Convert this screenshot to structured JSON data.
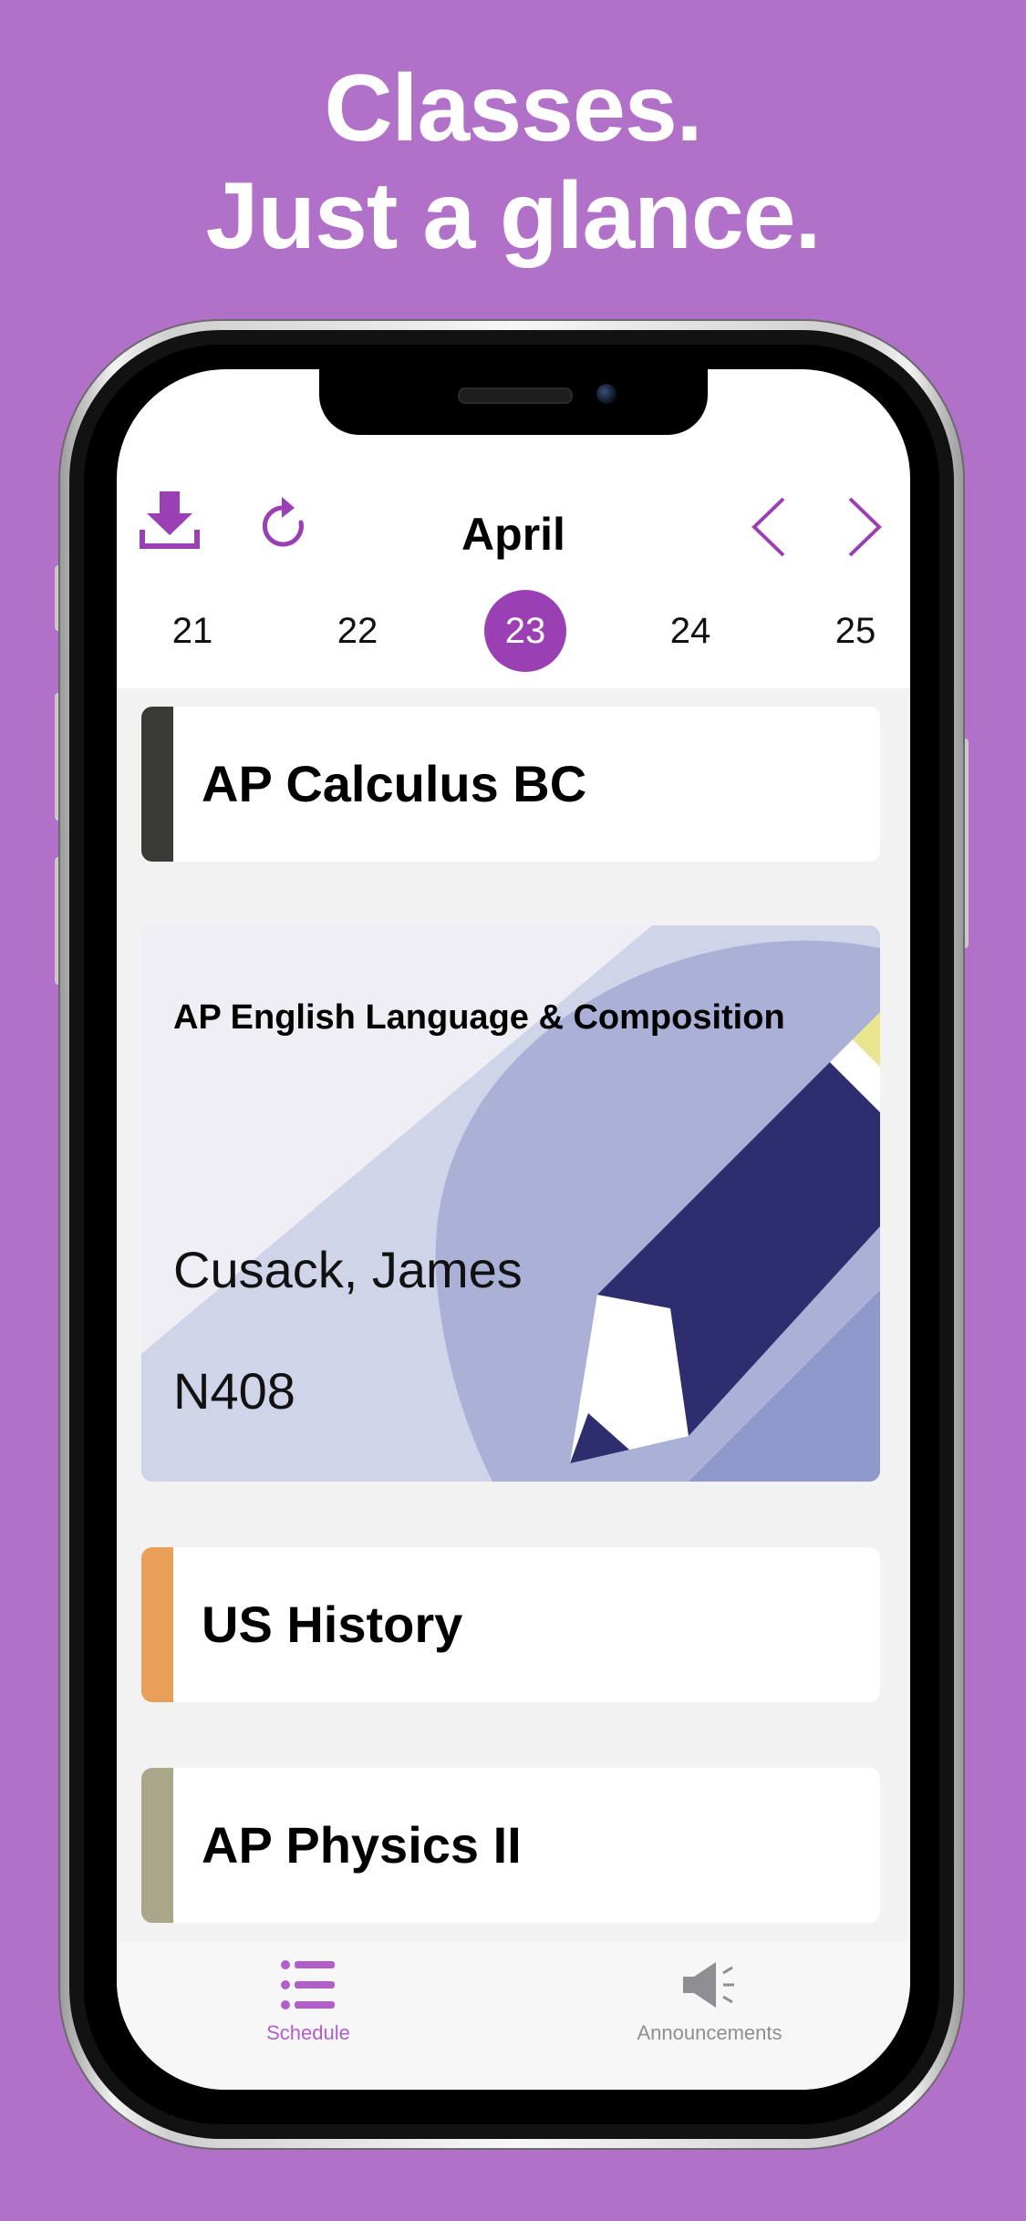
{
  "headline": {
    "line1": "Classes.",
    "line2": "Just a glance."
  },
  "header": {
    "month": "April",
    "icons": [
      "download-icon",
      "refresh-icon",
      "chevron-left-icon",
      "chevron-right-icon"
    ]
  },
  "dates": {
    "days": [
      "21",
      "22",
      "23",
      "24",
      "25"
    ],
    "selected": "23"
  },
  "classes": [
    {
      "title": "AP Calculus BC",
      "color": "#3a3a36"
    },
    {
      "title": "US History",
      "color": "#e8a058"
    },
    {
      "title": "AP Physics II",
      "color": "#aaa68a"
    }
  ],
  "featured": {
    "title": "AP English Language & Composition",
    "teacher": "Cusack, James",
    "room": "N408"
  },
  "tabs": {
    "schedule": "Schedule",
    "announcements": "Announcements"
  },
  "colors": {
    "background": "#b271c9",
    "accent": "#9a3fb4",
    "inactive": "#8e8e93"
  }
}
